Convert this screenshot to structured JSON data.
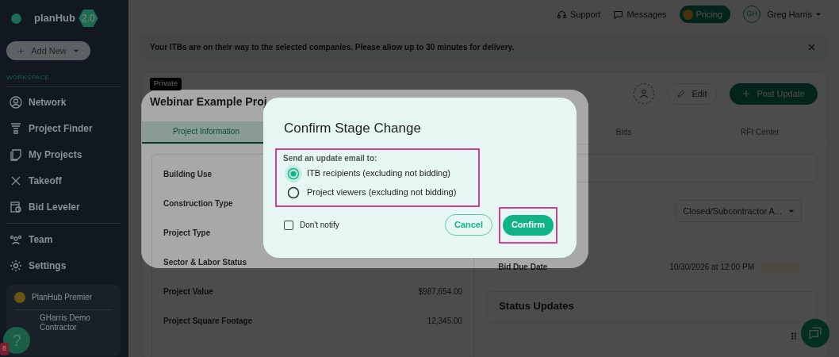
{
  "sidebar": {
    "logo": "planHub",
    "version": "2.0",
    "add_button": "Add New",
    "section": "WORKSPACE",
    "workspace_items": [
      {
        "label": "Network"
      },
      {
        "label": "Project Finder"
      },
      {
        "label": "My Projects"
      },
      {
        "label": "Takeoff"
      },
      {
        "label": "Bid Leveler"
      }
    ],
    "account_items": [
      {
        "label": "Team"
      },
      {
        "label": "Settings"
      }
    ],
    "plan": {
      "label": "PlanHub Premier",
      "company": "GHarris Demo Contractor"
    },
    "help": {
      "label": "?",
      "badge": "8"
    }
  },
  "topbar": {
    "links": [
      "Support",
      "Messages"
    ],
    "pricing": "Pricing",
    "avatar": "GH",
    "user": "Greg Harris"
  },
  "alert": {
    "text": "Your ITBs are on their way to the selected companies. Please allow up to 30 minutes for delivery."
  },
  "project": {
    "badge": "Private",
    "title": "Webinar Example Proj",
    "edit": "Edit",
    "post": "Post Update",
    "tabs": [
      {
        "label": "Project Information",
        "selected": true
      },
      {
        "label": "Bids",
        "selected": false
      },
      {
        "label": "RFI Center",
        "selected": false
      }
    ],
    "details": [
      {
        "label": "Building Use"
      },
      {
        "label": "Construction Type"
      },
      {
        "label": "Project Type"
      },
      {
        "label": "Sector & Labor Status"
      },
      {
        "label": "Project Value",
        "value": "$987,654.00"
      },
      {
        "label": "Project Square Footage",
        "value": "12,345.00"
      }
    ],
    "stage": "Closed/Subcontractor A...",
    "bid_due": {
      "label": "Bid Due Date",
      "value": "10/30/2026 at 12:00 PM"
    },
    "status_updates": "Status Updates"
  },
  "dialog": {
    "title": "Confirm Stage Change",
    "prompt": "Send an update email to:",
    "options": [
      {
        "label": "ITB recipients (excluding not bidding)",
        "selected": true
      },
      {
        "label": "Project viewers (excluding not bidding)",
        "selected": false
      }
    ],
    "dont_notify": {
      "label": "Don't notify",
      "checked": false
    },
    "cancel": "Cancel",
    "confirm": "Confirm"
  }
}
